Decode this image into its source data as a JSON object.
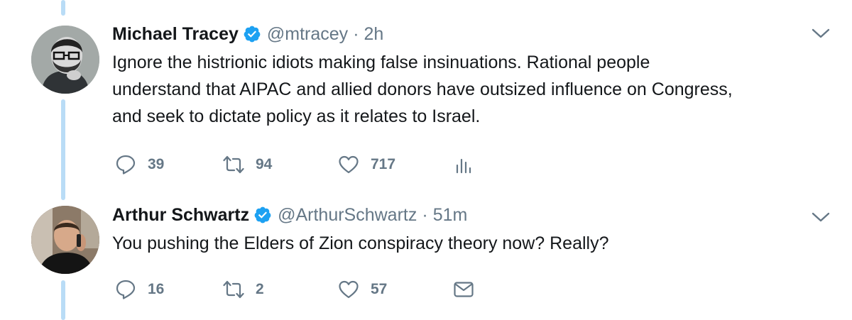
{
  "tweets": [
    {
      "name": "Michael Tracey",
      "handle": "@mtracey",
      "separator": "·",
      "time": "2h",
      "verified": true,
      "lines": [
        "Ignore the histrionic idiots making false insinuations. Rational people",
        "understand that AIPAC and allied donors have outsized influence on Congress,",
        "and seek to dictate policy as it relates to Israel."
      ],
      "replies": "39",
      "retweets": "94",
      "likes": "717",
      "extra_action_icon": "analytics-icon"
    },
    {
      "name": "Arthur Schwartz",
      "handle": "@ArthurSchwartz",
      "separator": "·",
      "time": "51m",
      "verified": true,
      "lines": [
        "You pushing the Elders of Zion conspiracy theory now? Really?"
      ],
      "replies": "16",
      "retweets": "2",
      "likes": "57",
      "extra_action_icon": "direct-message-icon"
    }
  ],
  "colors": {
    "thread_line": "#b9dcf6",
    "verified_badge": "#1da1f2",
    "secondary_text": "#657786",
    "primary_text": "#14171a"
  },
  "icons": [
    "verified-badge-icon",
    "chevron-down-icon",
    "reply-icon",
    "retweet-icon",
    "like-icon",
    "analytics-icon",
    "direct-message-icon"
  ]
}
